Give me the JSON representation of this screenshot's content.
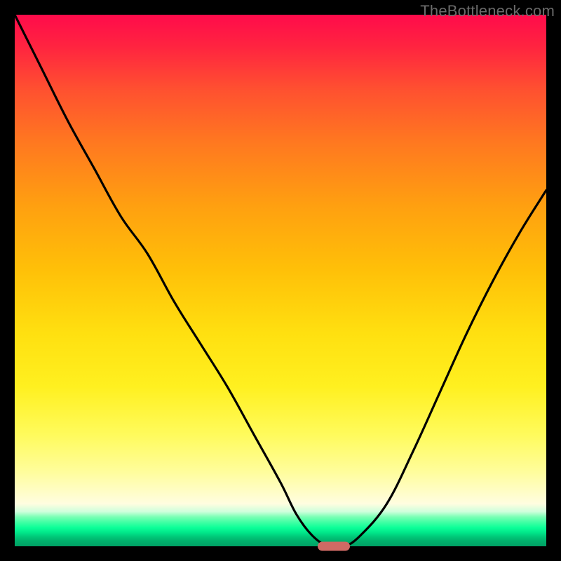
{
  "watermark": "TheBottleneck.com",
  "colors": {
    "curve_stroke": "#000000",
    "marker_fill": "#cf6a64",
    "frame_bg": "#000000"
  },
  "chart_data": {
    "type": "line",
    "title": "",
    "xlabel": "",
    "ylabel": "",
    "xlim": [
      0,
      100
    ],
    "ylim": [
      0,
      100
    ],
    "grid": false,
    "annotations": [
      "TheBottleneck.com"
    ],
    "series": [
      {
        "name": "bottleneck-curve",
        "x": [
          0,
          5,
          10,
          15,
          20,
          25,
          30,
          35,
          40,
          45,
          50,
          53,
          56,
          59,
          62,
          65,
          70,
          75,
          80,
          85,
          90,
          95,
          100
        ],
        "y": [
          100,
          90,
          80,
          71,
          62,
          55,
          46,
          38,
          30,
          21,
          12,
          6,
          2,
          0,
          0,
          2,
          8,
          18,
          29,
          40,
          50,
          59,
          67
        ]
      }
    ],
    "marker": {
      "x": 60,
      "y": 0
    },
    "gradient_stops": [
      {
        "pos": 0,
        "color": "#ff0b4b"
      },
      {
        "pos": 50,
        "color": "#ffd000"
      },
      {
        "pos": 92,
        "color": "#fffde0"
      },
      {
        "pos": 96,
        "color": "#20ff9c"
      },
      {
        "pos": 100,
        "color": "#00a064"
      }
    ]
  }
}
